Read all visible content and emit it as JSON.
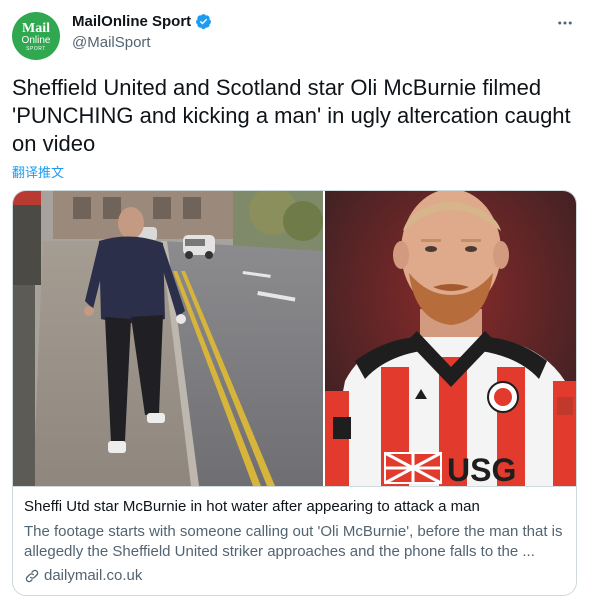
{
  "account": {
    "avatar_line1": "Mail",
    "avatar_line2": "Online",
    "avatar_line3": "SPORT",
    "display_name": "MailOnline Sport",
    "handle": "@MailSport"
  },
  "tweet": {
    "text": "Sheffield United and Scotland star Oli McBurnie filmed 'PUNCHING and kicking a man' in ugly altercation caught on video",
    "translate": "翻译推文"
  },
  "card": {
    "title": "Sheffi Utd star McBurnie in hot water after appearing to attack a man",
    "description": "The footage starts with someone calling out 'Oli McBurnie', before the man that is allegedly the Sheffield United striker approaches and the phone falls to the ...",
    "domain": "dailymail.co.uk"
  },
  "shirt": {
    "sponsor_left": "UNION",
    "sponsor_right": "USG"
  },
  "colors": {
    "link_blue": "#1d9bf0",
    "verified_blue": "#1d9bf0",
    "avatar_green": "#2fa84f",
    "secondary_text": "#536471",
    "border": "#cfd9de",
    "shirt_red": "#e23b2e"
  },
  "icons": [
    "verified-badge-icon",
    "more-options-icon",
    "link-icon"
  ]
}
